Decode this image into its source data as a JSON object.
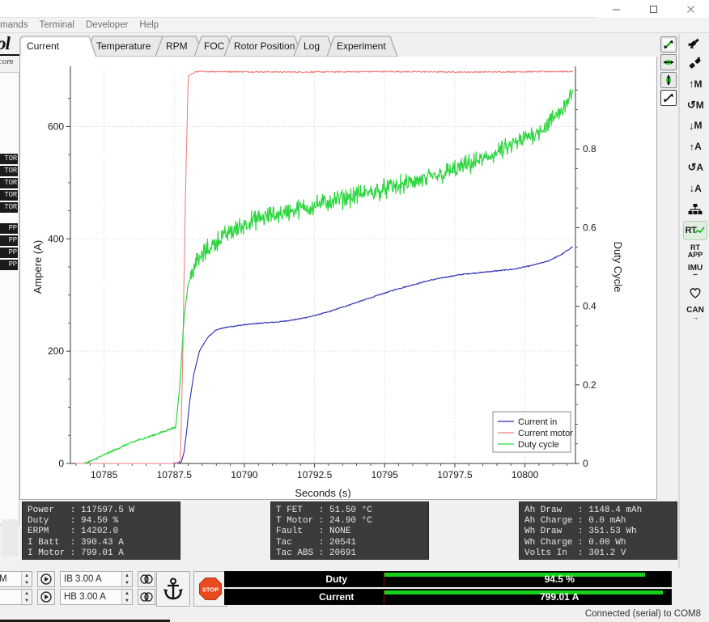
{
  "window": {
    "controls": {
      "minimize": "minimize-icon",
      "maximize": "maximize-icon",
      "close": "close-icon"
    }
  },
  "menubar": {
    "items": [
      "mands",
      "Terminal",
      "Developer",
      "Help"
    ]
  },
  "sidebar": {
    "logo_fragment": "ol",
    "logo_sub": "com",
    "chips": [
      "TOR",
      "TOR",
      "TOR",
      "TOR",
      "TOR",
      "PP",
      "PP",
      "PP",
      "PP"
    ]
  },
  "tabs": [
    {
      "label": "Current",
      "selected": true
    },
    {
      "label": "Temperature",
      "selected": false
    },
    {
      "label": "RPM",
      "selected": false
    },
    {
      "label": "FOC",
      "selected": false
    },
    {
      "label": "Rotor Position",
      "selected": false
    },
    {
      "label": "Log",
      "selected": false
    },
    {
      "label": "Experiment",
      "selected": false
    }
  ],
  "graph_tools": [
    {
      "name": "zoom-both-icon",
      "active": true
    },
    {
      "name": "zoom-horizontal-icon",
      "active": true
    },
    {
      "name": "zoom-vertical-icon",
      "active": true
    },
    {
      "name": "autoscale-icon",
      "active": false
    }
  ],
  "right_toolbar": [
    {
      "name": "connect-icon",
      "label": "",
      "active": false
    },
    {
      "name": "disconnect-icon",
      "label": "",
      "active": false
    },
    {
      "name": "motor-write-icon",
      "label": "M",
      "active": false
    },
    {
      "name": "motor-read-icon",
      "label": "M",
      "active": false
    },
    {
      "name": "motor-default-icon",
      "label": "M",
      "active": false
    },
    {
      "name": "app-write-icon",
      "label": "A",
      "active": false
    },
    {
      "name": "app-read-icon",
      "label": "A",
      "active": false
    },
    {
      "name": "app-default-icon",
      "label": "A",
      "active": false
    },
    {
      "name": "can-scan-icon",
      "label": "",
      "active": false
    },
    {
      "name": "realtime-data-icon",
      "label": "RT",
      "active": true
    },
    {
      "name": "realtime-app-icon",
      "label": "RT APP",
      "active": false
    },
    {
      "name": "imu-icon",
      "label": "IMU",
      "active": false
    },
    {
      "name": "health-icon",
      "label": "",
      "active": false
    },
    {
      "name": "can-icon",
      "label": "CAN",
      "active": false
    }
  ],
  "chart_data": {
    "type": "line",
    "title": "",
    "xlabel": "Seconds (s)",
    "ylabel": "Ampere (A)",
    "y2label": "Duty Cycle",
    "xlim": [
      10783.8,
      10801.8
    ],
    "ylim": [
      0,
      700
    ],
    "y2lim": [
      0,
      1.0
    ],
    "xticks": [
      10785,
      10787.5,
      10790,
      10792.5,
      10795,
      10797.5,
      10800
    ],
    "xticklabels": [
      "10785",
      "10787.5",
      "10790",
      "10792.5",
      "10795",
      "10797.5",
      "10800"
    ],
    "yticks": [
      0,
      200,
      400,
      600
    ],
    "yticklabels": [
      "0",
      "200",
      "400",
      "600"
    ],
    "y2ticks": [
      0,
      0.2,
      0.4,
      0.6,
      0.8
    ],
    "y2ticklabels": [
      "0",
      "0.2",
      "0.4",
      "0.6",
      "0.8"
    ],
    "grid": true,
    "legend_position": "lower right",
    "series": [
      {
        "name": "Current in",
        "color": "#2b2bb5",
        "axis": "left",
        "x": [
          10784.0,
          10786.0,
          10787.4,
          10787.75,
          10787.85,
          10787.95,
          10788.05,
          10788.2,
          10788.4,
          10788.7,
          10789.0,
          10789.4,
          10790.0,
          10790.6,
          10791.2,
          10791.8,
          10792.4,
          10793.0,
          10793.6,
          10794.2,
          10794.8,
          10795.4,
          10796.0,
          10796.6,
          10797.2,
          10797.8,
          10798.4,
          10799.0,
          10799.6,
          10800.2,
          10800.8,
          10801.3,
          10801.7
        ],
        "y": [
          0,
          0,
          0,
          2,
          20,
          60,
          110,
          160,
          200,
          225,
          238,
          243,
          247,
          250,
          252,
          256,
          262,
          270,
          280,
          290,
          300,
          310,
          318,
          326,
          332,
          337,
          340,
          343,
          346,
          352,
          360,
          372,
          386
        ]
      },
      {
        "name": "Current motor",
        "color": "#f08080",
        "axis": "left",
        "x": [
          10784.0,
          10787.4,
          10787.6,
          10787.72,
          10787.8,
          10787.9,
          10788.0,
          10788.3,
          10789.0,
          10792.0,
          10795.0,
          10798.0,
          10801.0,
          10801.7
        ],
        "y": [
          0,
          0,
          0,
          5,
          180,
          480,
          690,
          698,
          698,
          697,
          698,
          697,
          698,
          698
        ]
      },
      {
        "name": "Duty cycle",
        "color": "#2fd641",
        "axis": "right",
        "x": [
          10784.3,
          10784.6,
          10785.0,
          10785.4,
          10785.8,
          10786.2,
          10786.6,
          10787.0,
          10787.3,
          10787.55,
          10787.7,
          10787.85,
          10788.0,
          10788.2,
          10788.45,
          10788.7,
          10789.0,
          10789.4,
          10789.8,
          10790.2,
          10790.7,
          10791.2,
          10791.8,
          10792.4,
          10793.0,
          10793.6,
          10794.2,
          10794.8,
          10795.4,
          10796.0,
          10796.6,
          10797.2,
          10797.8,
          10798.4,
          10799.0,
          10799.6,
          10800.2,
          10800.8,
          10801.3,
          10801.7
        ],
        "y": [
          0.0,
          0.008,
          0.022,
          0.035,
          0.048,
          0.059,
          0.068,
          0.078,
          0.086,
          0.092,
          0.2,
          0.37,
          0.46,
          0.5,
          0.525,
          0.545,
          0.565,
          0.585,
          0.6,
          0.615,
          0.625,
          0.635,
          0.645,
          0.655,
          0.665,
          0.675,
          0.685,
          0.695,
          0.705,
          0.715,
          0.725,
          0.74,
          0.755,
          0.77,
          0.79,
          0.81,
          0.835,
          0.86,
          0.9,
          0.945
        ]
      }
    ],
    "legend": [
      "Current in",
      "Current motor",
      "Duty cycle"
    ]
  },
  "data_panels": {
    "left": [
      {
        "key": "Power",
        "value": "117597.5 W"
      },
      {
        "key": "Duty",
        "value": "94.50 %"
      },
      {
        "key": "ERPM",
        "value": "14202.0"
      },
      {
        "key": "I Batt",
        "value": "390.43 A"
      },
      {
        "key": "I Motor",
        "value": "799.01 A"
      }
    ],
    "middle": [
      {
        "key": "T FET",
        "value": "51.50 °C"
      },
      {
        "key": "T Motor",
        "value": "24.90 °C"
      },
      {
        "key": "Fault",
        "value": "NONE"
      },
      {
        "key": "Tac",
        "value": "20541"
      },
      {
        "key": "Tac ABS",
        "value": "20691"
      }
    ],
    "right": [
      {
        "key": "Ah Draw",
        "value": "1148.4 mAh"
      },
      {
        "key": "Ah Charge",
        "value": "0.0 mAh"
      },
      {
        "key": "Wh Draw",
        "value": "351.53 Wh"
      },
      {
        "key": "Wh Charge",
        "value": "0.00 Wh"
      },
      {
        "key": "Volts In",
        "value": "301.2 V"
      }
    ]
  },
  "controls": {
    "rpm_label": "RPM",
    "row1_field": "IB 3.00 A",
    "row2_field": "HB 3.00 A",
    "play_icon": "play-circle-icon",
    "loop_icon": "loop-icon",
    "anchor_icon": "anchor-icon",
    "stop_icon": "stop-icon",
    "stop_text": "STOP"
  },
  "gauges": [
    {
      "name": "Duty",
      "value_text": "94.5 %",
      "percent": 94.5
    },
    {
      "name": "Current",
      "value_text": "799.01 A",
      "percent": 99.5
    }
  ],
  "statusbar": {
    "text": "Connected (serial) to COM8"
  }
}
